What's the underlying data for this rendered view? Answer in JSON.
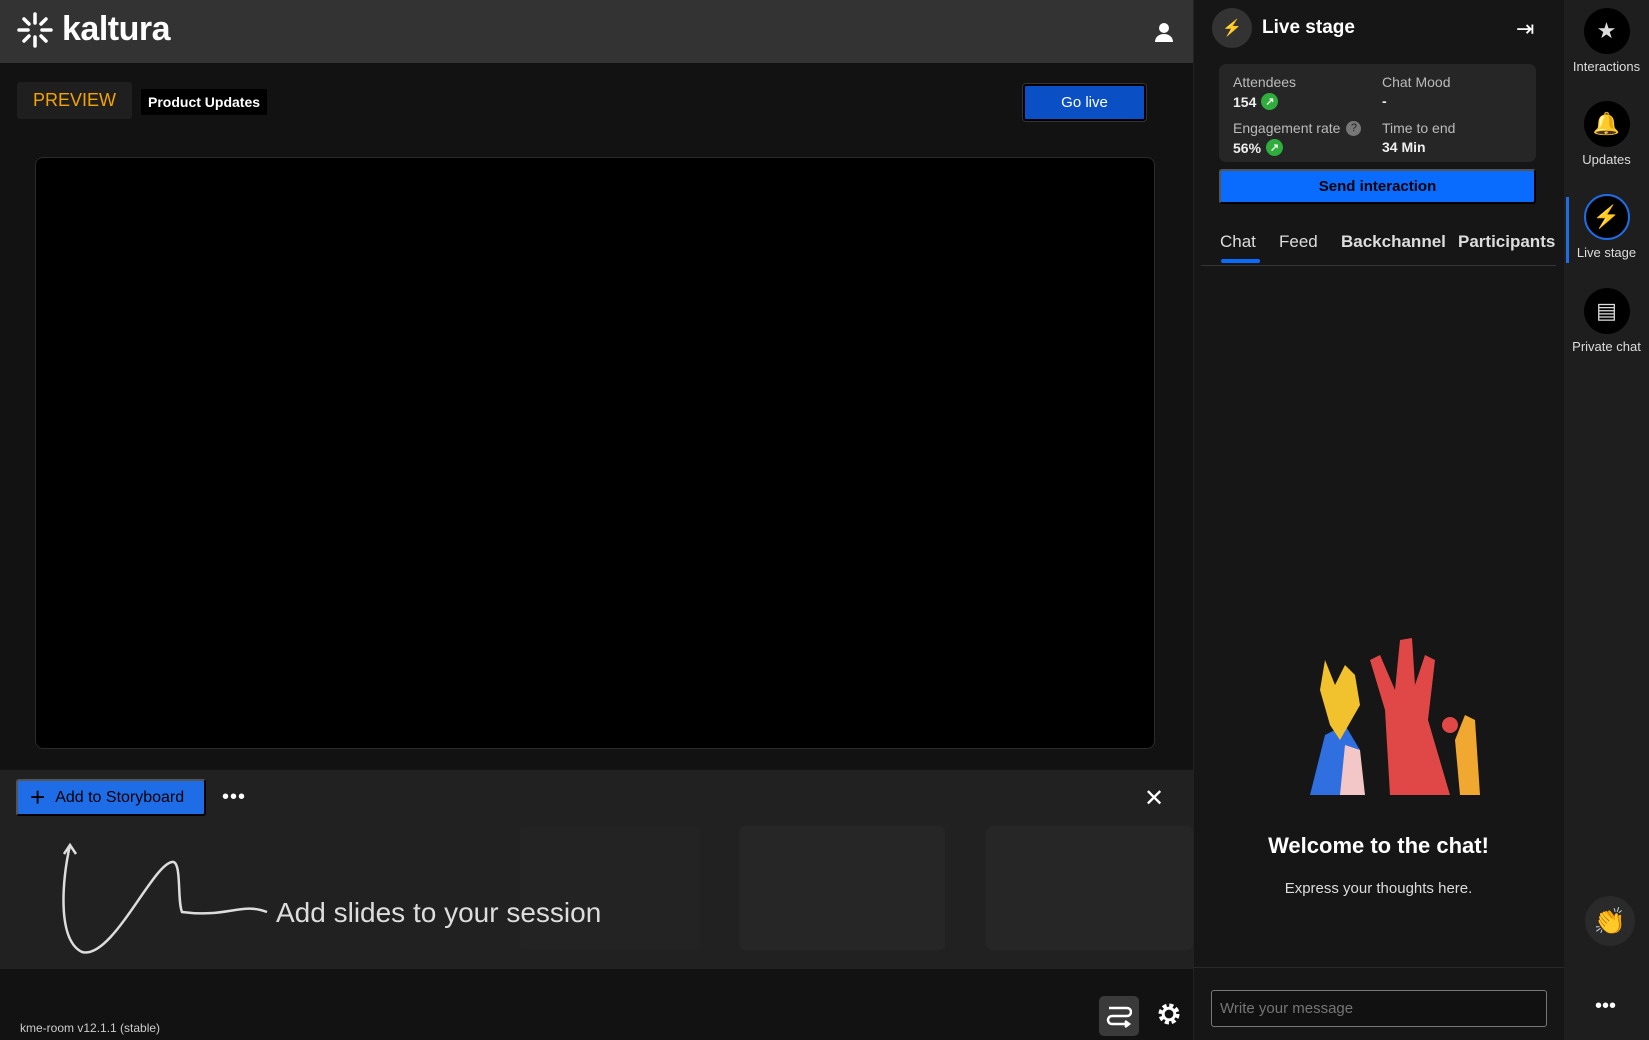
{
  "header": {
    "logo_text": "kaltura"
  },
  "stage": {
    "mode_label": "PREVIEW",
    "session_title": "Product Updates",
    "go_live_label": "Go live"
  },
  "storyboard": {
    "add_label": "Add to Storyboard",
    "more_label": "•••",
    "close_label": "✕",
    "hint": "Add slides to your session"
  },
  "footer": {
    "version": "kme-room v12.1.1 (stable)"
  },
  "panel": {
    "title": "Live stage",
    "stats": {
      "attendees_label": "Attendees",
      "attendees_value": "154",
      "mood_label": "Chat Mood",
      "mood_value": "-",
      "engagement_label": "Engagement rate",
      "engagement_value": "56%",
      "time_label": "Time to end",
      "time_value": "34 Min"
    },
    "send_label": "Send interaction",
    "tabs": [
      "Chat",
      "Feed",
      "Backchannel",
      "Participants"
    ],
    "active_tab": "Chat",
    "welcome_title": "Welcome to the chat!",
    "welcome_sub": "Express your thoughts here.",
    "message_placeholder": "Write your message"
  },
  "rail": {
    "items": [
      "Interactions",
      "Updates",
      "Live stage",
      "Private chat"
    ],
    "more_label": "•••"
  },
  "colors": {
    "accent": "#0a6cff",
    "preview": "#f5a300",
    "trend_up": "#2fae3e"
  }
}
